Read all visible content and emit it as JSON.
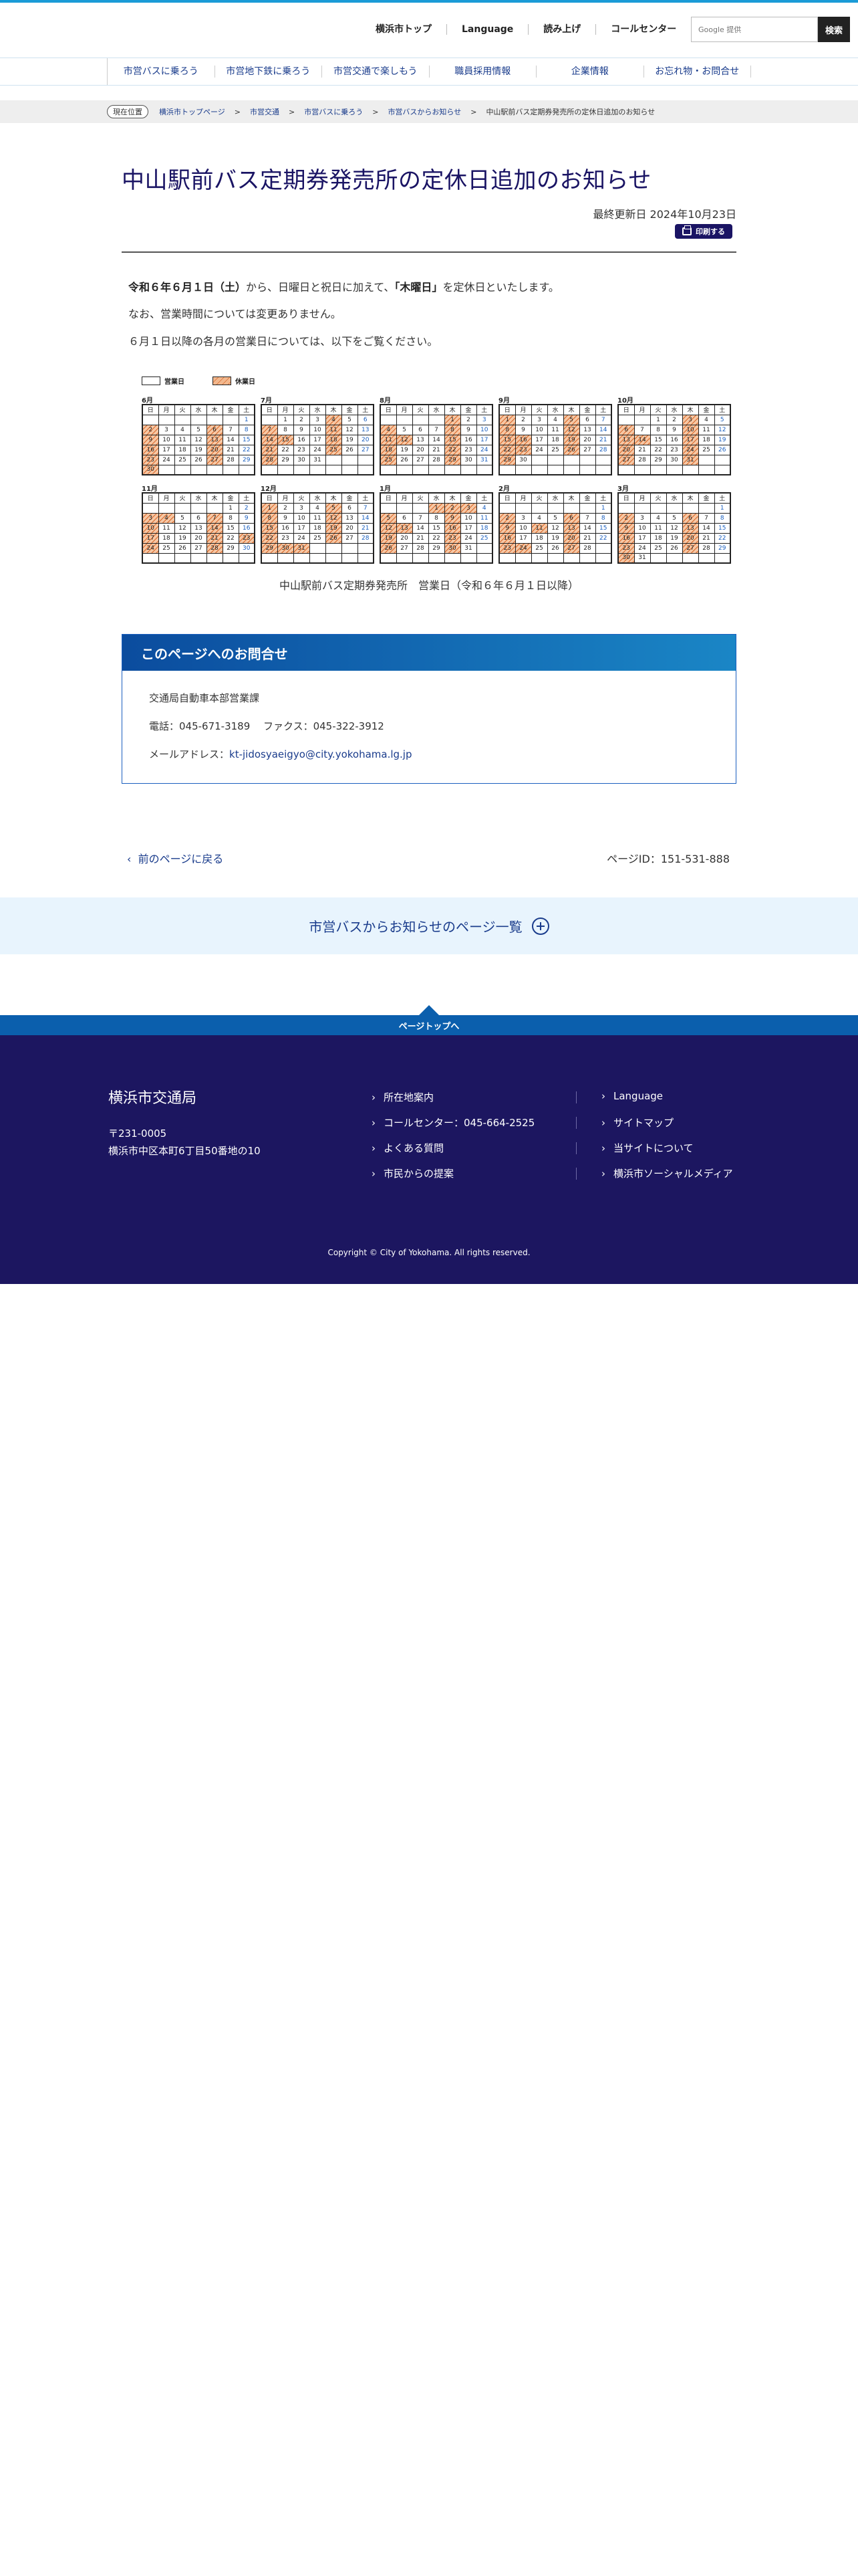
{
  "header": {
    "links": [
      "横浜市トップ",
      "Language",
      "読み上げ",
      "コールセンター"
    ],
    "search_placeholder": "Google 提供",
    "search_button": "検索"
  },
  "gnav": [
    "市営バスに乗ろう",
    "市営地下鉄に乗ろう",
    "市営交通で楽しもう",
    "職員採用情報",
    "企業情報",
    "お忘れ物・お問合せ"
  ],
  "breadcrumb": {
    "label": "現在位置",
    "items": [
      "横浜市トップページ",
      "市営交通",
      "市営バスに乗ろう",
      "市営バスからお知らせ"
    ],
    "current": "中山駅前バス定期券発売所の定休日追加のお知らせ",
    "sep": ">"
  },
  "page": {
    "title": "中山駅前バス定期券発売所の定休日追加のお知らせ",
    "updated": "最終更新日 2024年10月23日",
    "print": "印刷する",
    "p1_a": "令和６年６月１日（土）",
    "p1_b": "から、日曜日と祝日に加えて、",
    "p1_c": "「木曜日」",
    "p1_d": "を定休日といたします。",
    "p2": "なお、営業時間については変更ありません。",
    "p3": "６月１日以降の各月の営業日については、以下をご覧ください。"
  },
  "calendar": {
    "legend_open": "営業日",
    "legend_closed": "休業日",
    "weekdays": [
      "日",
      "月",
      "火",
      "水",
      "木",
      "金",
      "土"
    ],
    "caption": "中山駅前バス定期券発売所　営業日（令和６年６月１日以降）",
    "months": [
      {
        "label": "6月",
        "start": 6,
        "days": 30,
        "holidays": []
      },
      {
        "label": "7月",
        "start": 1,
        "days": 31,
        "holidays": [
          15
        ]
      },
      {
        "label": "8月",
        "start": 4,
        "days": 31,
        "holidays": [
          11,
          12
        ]
      },
      {
        "label": "9月",
        "start": 0,
        "days": 30,
        "holidays": [
          16,
          22,
          23
        ]
      },
      {
        "label": "10月",
        "start": 2,
        "days": 31,
        "holidays": [
          14
        ]
      },
      {
        "label": "11月",
        "start": 5,
        "days": 30,
        "holidays": [
          3,
          4,
          23
        ]
      },
      {
        "label": "12月",
        "start": 0,
        "days": 31,
        "holidays": [
          29,
          30,
          31
        ]
      },
      {
        "label": "1月",
        "start": 3,
        "days": 31,
        "holidays": [
          1,
          2,
          3,
          13
        ]
      },
      {
        "label": "2月",
        "start": 6,
        "days": 28,
        "holidays": [
          11,
          23,
          24
        ]
      },
      {
        "label": "3月",
        "start": 6,
        "days": 31,
        "holidays": [
          20
        ]
      }
    ]
  },
  "contact": {
    "heading": "このページへのお問合せ",
    "dept": "交通局自動車本部営業課",
    "phone": "電話：045-671-3189　 ファクス：045-322-3912",
    "mail_label": "メールアドレス：",
    "mail": "kt-jidosyaeigyo@city.yokohama.lg.jp"
  },
  "nav": {
    "back": "前のページに戻る",
    "page_id": "ページID：151-531-888"
  },
  "list_band": "市営バスからお知らせのページ一覧",
  "pagetop": "ページトップへ",
  "footer": {
    "org": "横浜市交通局",
    "zip": "〒231-0005",
    "address": "横浜市中区本町6丁目50番地の10",
    "links_left": [
      "所在地案内",
      "コールセンター：045-664-2525",
      "よくある質問",
      "市民からの提案"
    ],
    "links_right": [
      "Language",
      "サイトマップ",
      "当サイトについて",
      "横浜市ソーシャルメディア"
    ],
    "copyright": "Copyright © City of Yokohama. All rights reserved."
  }
}
